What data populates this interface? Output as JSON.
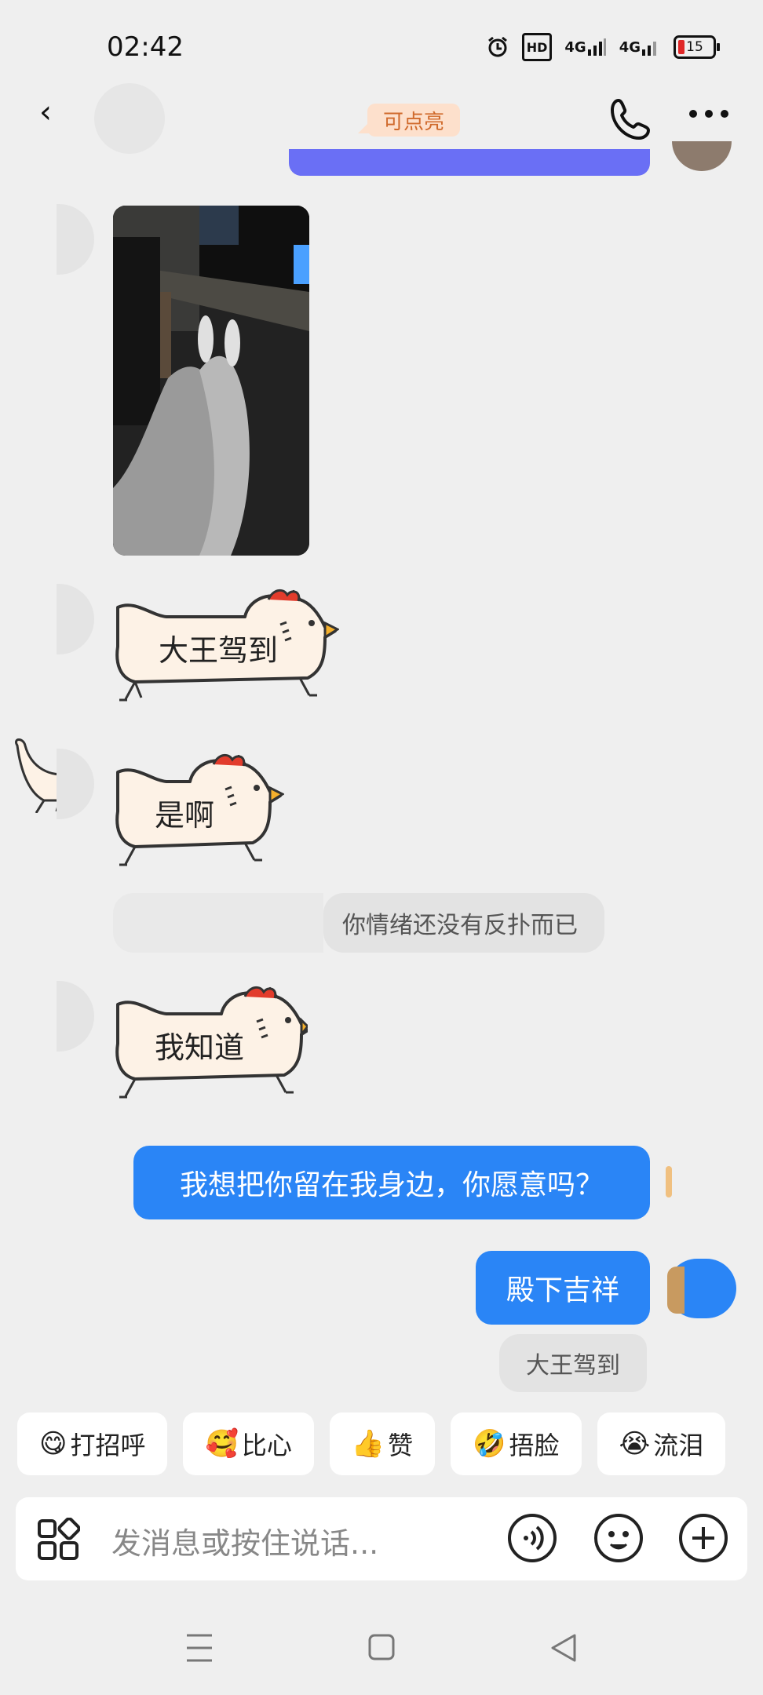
{
  "status_bar": {
    "time": "02:42",
    "hd_label": "HD",
    "net1": "4G",
    "net2": "4G",
    "battery": "15"
  },
  "header": {
    "back_icon": "chevron-left-icon",
    "tag_label": "可点亮",
    "call_icon": "phone-icon",
    "more_icon": "more-icon"
  },
  "messages": {
    "sticker1_text": "大王驾到",
    "sticker2_text": "是啊",
    "quote_reply": "你情绪还没有反扑而已",
    "sticker3_text": "我知道",
    "sent1": "我想把你留在我身边，你愿意吗？",
    "sent2": "殿下吉祥",
    "quote_sent": "大王驾到"
  },
  "quick_replies": [
    {
      "emoji": "😋",
      "label": "打招呼"
    },
    {
      "emoji": "🥰",
      "label": "比心"
    },
    {
      "emoji": "👍",
      "label": "赞"
    },
    {
      "emoji": "🤣",
      "label": "捂脸"
    },
    {
      "emoji": "😭",
      "label": "流泪"
    }
  ],
  "input": {
    "placeholder": "发消息或按住说话..."
  },
  "colors": {
    "accent": "#2a85f6",
    "background": "#efefef",
    "tag_bg": "#fde0cc",
    "tag_text": "#d06a2c"
  }
}
